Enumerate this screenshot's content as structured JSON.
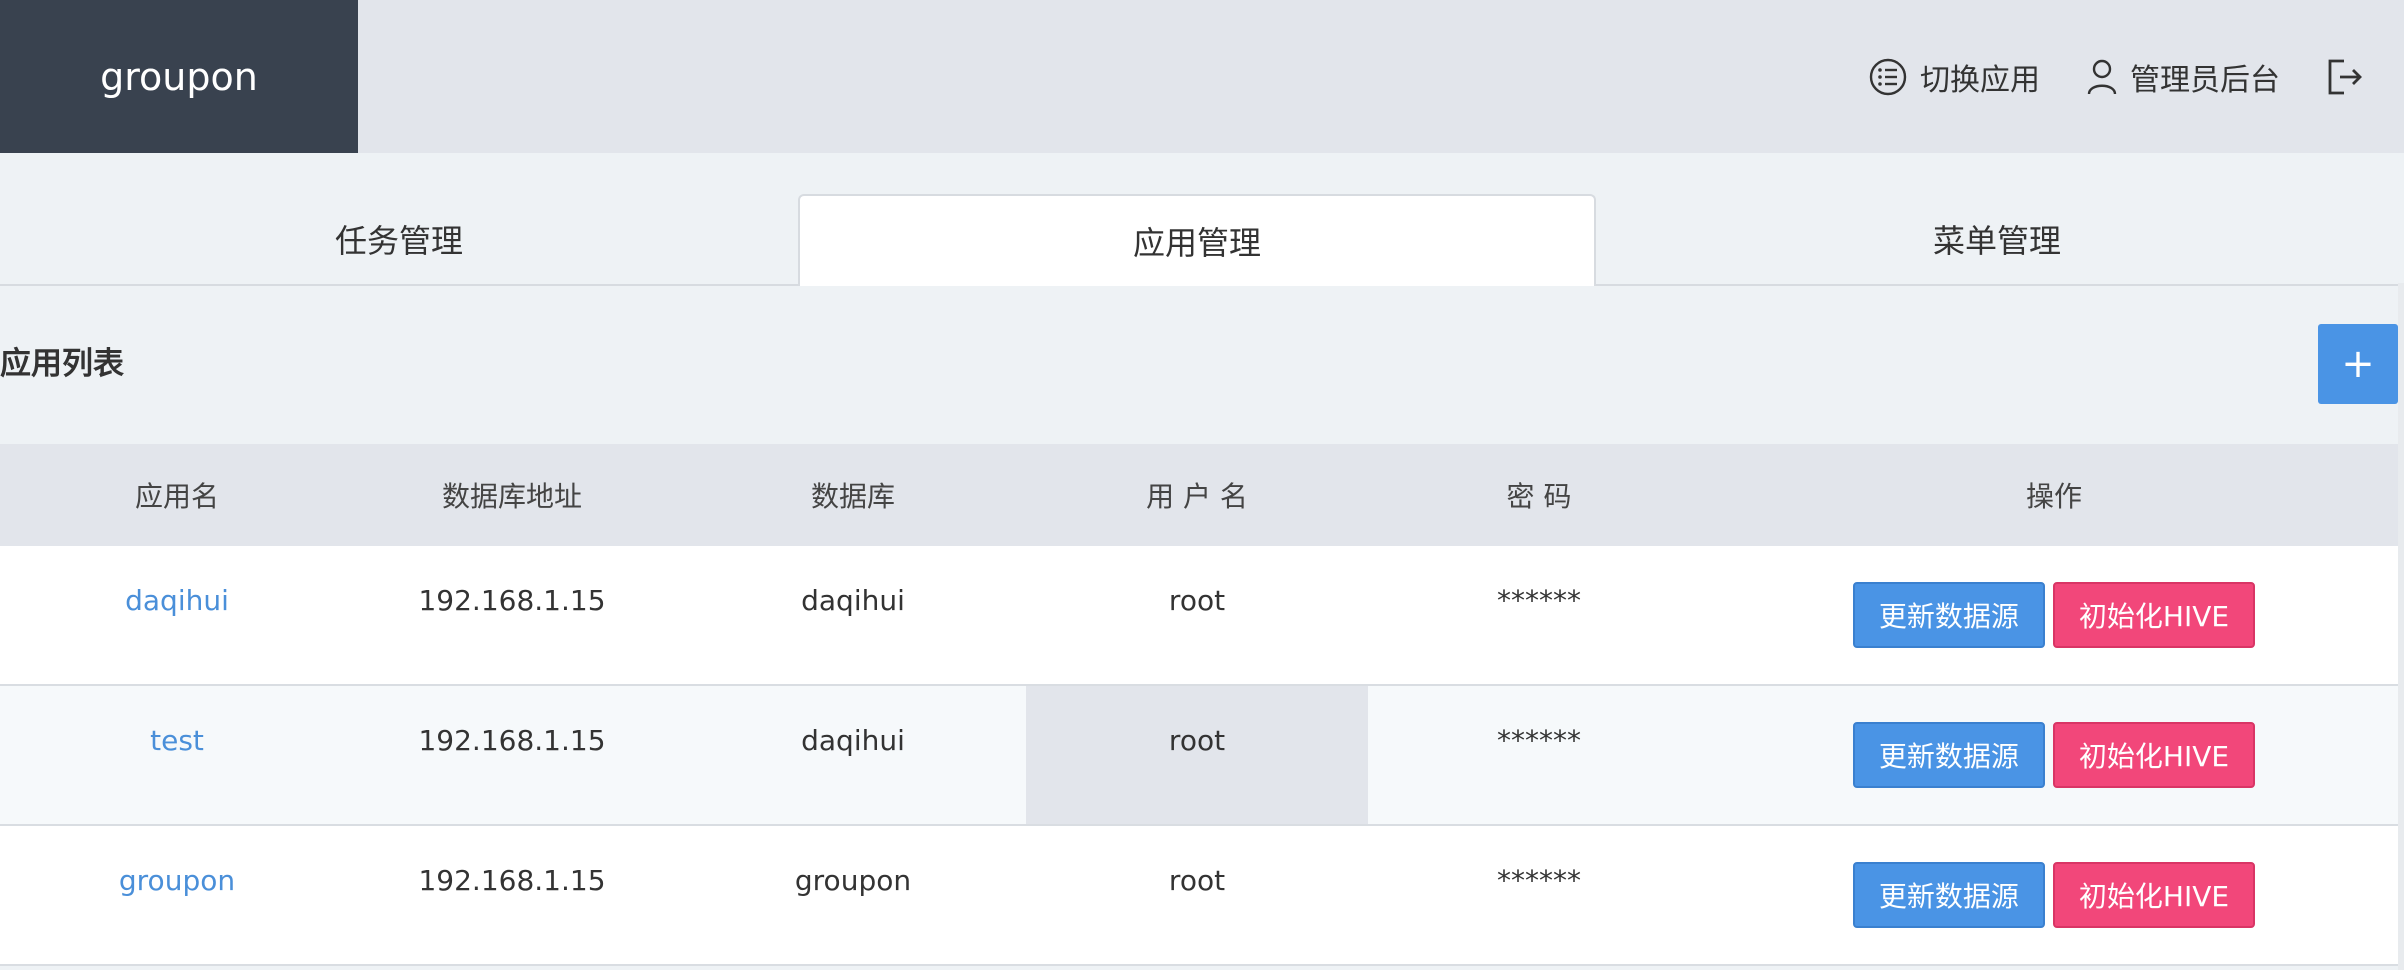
{
  "header": {
    "brand": "groupon",
    "switch_app": "切换应用",
    "admin_console": "管理员后台"
  },
  "tabs": [
    {
      "label": "任务管理",
      "active": false
    },
    {
      "label": "应用管理",
      "active": true
    },
    {
      "label": "菜单管理",
      "active": false
    }
  ],
  "section": {
    "title": "应用列表",
    "add_label": "+"
  },
  "table": {
    "columns": [
      "应用名",
      "数据库地址",
      "数据库",
      "用 户 名",
      "密 码",
      "操作"
    ],
    "rows": [
      {
        "app": "daqihui",
        "db_address": "192.168.1.15",
        "database": "daqihui",
        "username": "root",
        "password": "******",
        "update_label": "更新数据源",
        "init_label": "初始化HIVE"
      },
      {
        "app": "test",
        "db_address": "192.168.1.15",
        "database": "daqihui",
        "username": "root",
        "password": "******",
        "update_label": "更新数据源",
        "init_label": "初始化HIVE"
      },
      {
        "app": "groupon",
        "db_address": "192.168.1.15",
        "database": "groupon",
        "username": "root",
        "password": "******",
        "update_label": "更新数据源",
        "init_label": "初始化HIVE"
      }
    ]
  },
  "colors": {
    "brand_bg": "#39424f",
    "primary": "#4a94e5",
    "danger": "#f2477a",
    "link": "#4a8fd9"
  },
  "icons": [
    "switch-app-icon",
    "user-icon",
    "logout-icon",
    "plus-icon"
  ]
}
